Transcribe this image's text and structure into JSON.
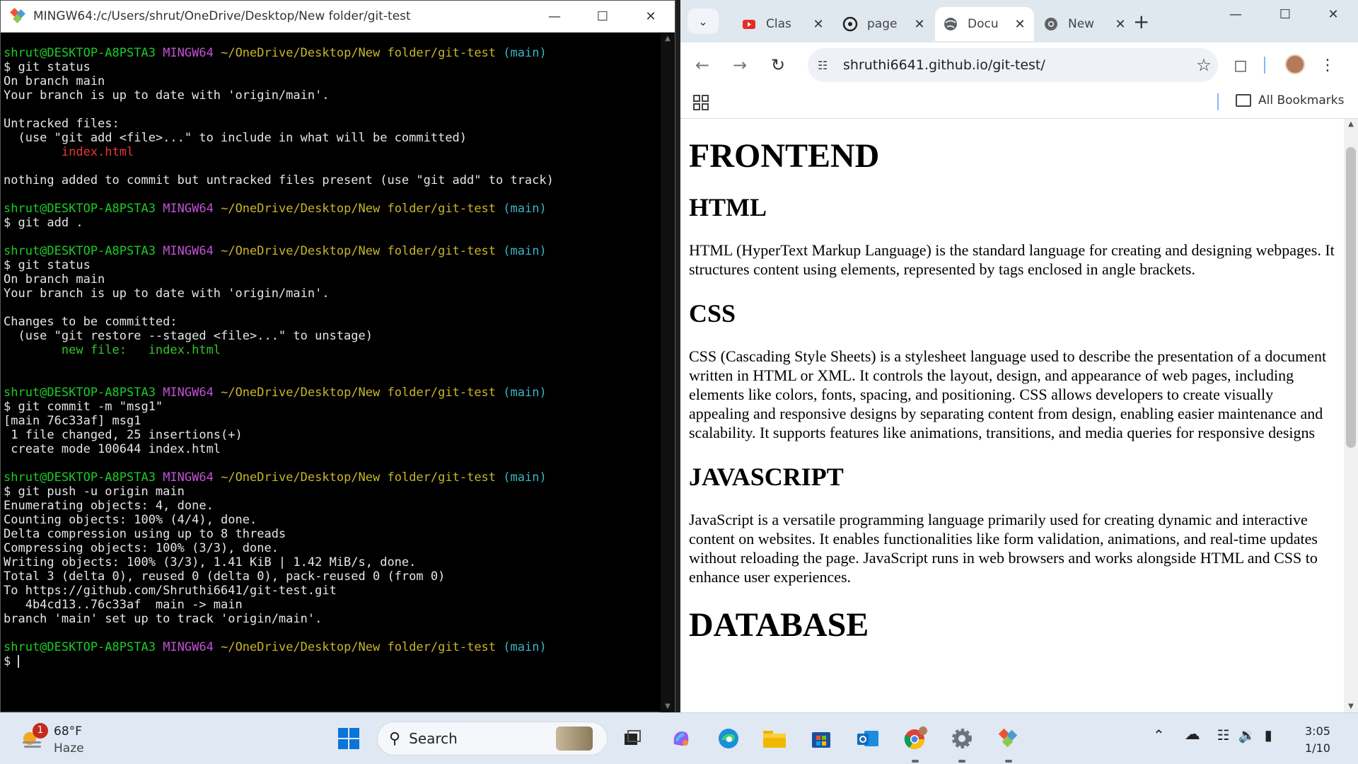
{
  "terminal": {
    "title": "MINGW64:/c/Users/shrut/OneDrive/Desktop/New folder/git-test",
    "prompt": {
      "user": "shrut@DESKTOP-A8PSTA3",
      "system": "MINGW64",
      "path": "~/OneDrive/Desktop/New folder/git-test",
      "branch": "(main)"
    },
    "lines": [
      {
        "type": "prompt"
      },
      {
        "type": "text",
        "text": "$ git status"
      },
      {
        "type": "text",
        "text": "On branch main"
      },
      {
        "type": "text",
        "text": "Your branch is up to date with 'origin/main'."
      },
      {
        "type": "blank"
      },
      {
        "type": "text",
        "text": "Untracked files:"
      },
      {
        "type": "text",
        "text": "  (use \"git add <file>...\" to include in what will be committed)"
      },
      {
        "type": "red",
        "text": "        index.html"
      },
      {
        "type": "blank"
      },
      {
        "type": "text",
        "text": "nothing added to commit but untracked files present (use \"git add\" to track)"
      },
      {
        "type": "blank"
      },
      {
        "type": "prompt"
      },
      {
        "type": "text",
        "text": "$ git add ."
      },
      {
        "type": "blank"
      },
      {
        "type": "prompt"
      },
      {
        "type": "text",
        "text": "$ git status"
      },
      {
        "type": "text",
        "text": "On branch main"
      },
      {
        "type": "text",
        "text": "Your branch is up to date with 'origin/main'."
      },
      {
        "type": "blank"
      },
      {
        "type": "text",
        "text": "Changes to be committed:"
      },
      {
        "type": "text",
        "text": "  (use \"git restore --staged <file>...\" to unstage)"
      },
      {
        "type": "green",
        "text": "        new file:   index.html"
      },
      {
        "type": "blank"
      },
      {
        "type": "blank"
      },
      {
        "type": "prompt"
      },
      {
        "type": "text",
        "text": "$ git commit -m \"msg1\""
      },
      {
        "type": "text",
        "text": "[main 76c33af] msg1"
      },
      {
        "type": "text",
        "text": " 1 file changed, 25 insertions(+)"
      },
      {
        "type": "text",
        "text": " create mode 100644 index.html"
      },
      {
        "type": "blank"
      },
      {
        "type": "prompt"
      },
      {
        "type": "text",
        "text": "$ git push -u origin main"
      },
      {
        "type": "text",
        "text": "Enumerating objects: 4, done."
      },
      {
        "type": "text",
        "text": "Counting objects: 100% (4/4), done."
      },
      {
        "type": "text",
        "text": "Delta compression using up to 8 threads"
      },
      {
        "type": "text",
        "text": "Compressing objects: 100% (3/3), done."
      },
      {
        "type": "text",
        "text": "Writing objects: 100% (3/3), 1.41 KiB | 1.42 MiB/s, done."
      },
      {
        "type": "text",
        "text": "Total 3 (delta 0), reused 0 (delta 0), pack-reused 0 (from 0)"
      },
      {
        "type": "text",
        "text": "To https://github.com/Shruthi6641/git-test.git"
      },
      {
        "type": "text",
        "text": "   4b4cd13..76c33af  main -> main"
      },
      {
        "type": "text",
        "text": "branch 'main' set up to track 'origin/main'."
      },
      {
        "type": "blank"
      },
      {
        "type": "prompt"
      },
      {
        "type": "input",
        "text": "$ "
      }
    ]
  },
  "browser": {
    "tabs": [
      {
        "label": "Clas",
        "icon": "youtube-icon"
      },
      {
        "label": "page",
        "icon": "github-icon"
      },
      {
        "label": "Docu",
        "icon": "globe-icon",
        "active": true
      },
      {
        "label": "New",
        "icon": "chrome-icon"
      }
    ],
    "url": "shruthi6641.github.io/git-test/",
    "bookmarks_label": "All Bookmarks"
  },
  "page": {
    "title": "FRONTEND",
    "sections": [
      {
        "heading": "HTML",
        "body": "HTML (HyperText Markup Language) is the standard language for creating and designing webpages. It structures content using elements, represented by tags enclosed in angle brackets."
      },
      {
        "heading": "CSS",
        "body": "CSS (Cascading Style Sheets) is a stylesheet language used to describe the presentation of a document written in HTML or XML. It controls the layout, design, and appearance of web pages, including elements like colors, fonts, spacing, and positioning. CSS allows developers to create visually appealing and responsive designs by separating content from design, enabling easier maintenance and scalability. It supports features like animations, transitions, and media queries for responsive designs"
      },
      {
        "heading": "JAVASCRIPT",
        "body": "JavaScript is a versatile programming language primarily used for creating dynamic and interactive content on websites. It enables functionalities like form validation, animations, and real-time updates without reloading the page. JavaScript runs in web browsers and works alongside HTML and CSS to enhance user experiences."
      }
    ],
    "next_title": "DATABASE"
  },
  "taskbar": {
    "weather_temp": "68°F",
    "weather_desc": "Haze",
    "weather_badge": "1",
    "search_placeholder": "Search",
    "time": "3:05",
    "date": "1/10"
  }
}
